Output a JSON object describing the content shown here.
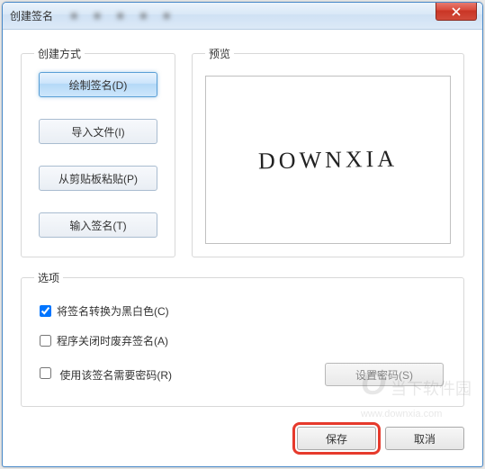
{
  "window": {
    "title": "创建签名"
  },
  "create_method": {
    "legend": "创建方式",
    "buttons": {
      "draw": "绘制签名(D)",
      "import": "导入文件(I)",
      "paste": "从剪贴板粘贴(P)",
      "type": "输入签名(T)"
    }
  },
  "preview": {
    "legend": "预览",
    "content": "DOWNXIA"
  },
  "options": {
    "legend": "选项",
    "convert_bw": {
      "label": "将签名转换为黑白色(C)",
      "checked": true
    },
    "discard": {
      "label": "程序关闭时废弃签名(A)",
      "checked": false
    },
    "password": {
      "label": "使用该签名需要密码(R)",
      "checked": false
    },
    "set_password_btn": "设置密码(S)"
  },
  "actions": {
    "save": "保存",
    "cancel": "取消"
  },
  "watermark": {
    "text": "当下软件园",
    "url": "www.downxia.com"
  }
}
